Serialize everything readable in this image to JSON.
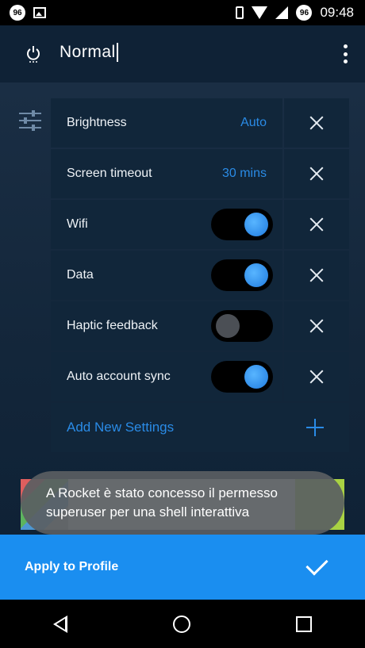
{
  "status_bar": {
    "left_badge": "96",
    "right_badge": "96",
    "time": "09:48"
  },
  "app_bar": {
    "title": "Normal"
  },
  "settings": [
    {
      "label": "Brightness",
      "value": "Auto",
      "type": "value"
    },
    {
      "label": "Screen timeout",
      "value": "30 mins",
      "type": "value"
    },
    {
      "label": "Wifi",
      "type": "toggle",
      "on": true
    },
    {
      "label": "Data",
      "type": "toggle",
      "on": true
    },
    {
      "label": "Haptic feedback",
      "type": "toggle",
      "on": false
    },
    {
      "label": "Auto account sync",
      "type": "toggle",
      "on": true
    }
  ],
  "add_row": {
    "label": "Add New Settings"
  },
  "toast": {
    "text": "A Rocket è stato concesso il permesso superuser per una shell interattiva"
  },
  "apply_bar": {
    "label": "Apply to Profile"
  },
  "colors": {
    "accent": "#1a8ef0",
    "link": "#2a8be6",
    "card": "#11263a"
  }
}
